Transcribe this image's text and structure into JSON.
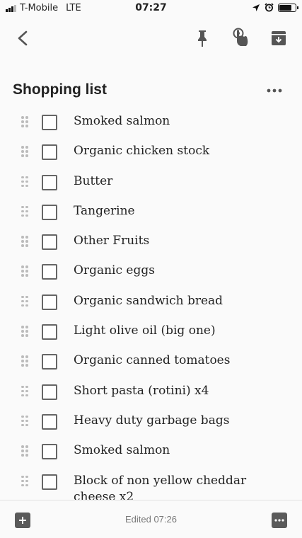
{
  "status_bar": {
    "carrier": "T-Mobile",
    "network": "LTE",
    "time": "07:27",
    "battery_level": 0.85
  },
  "toolbar": {
    "icons": [
      "back-arrow-icon",
      "pin-icon",
      "reminder-icon",
      "archive-icon"
    ]
  },
  "note": {
    "title": "Shopping list",
    "items": [
      {
        "text": "Smoked salmon",
        "checked": false
      },
      {
        "text": "Organic chicken stock",
        "checked": false
      },
      {
        "text": "Butter",
        "checked": false
      },
      {
        "text": "Tangerine",
        "checked": false
      },
      {
        "text": "Other Fruits",
        "checked": false
      },
      {
        "text": "Organic eggs",
        "checked": false
      },
      {
        "text": "Organic sandwich bread",
        "checked": false
      },
      {
        "text": "Light olive oil (big one)",
        "checked": false
      },
      {
        "text": "Organic canned tomatoes",
        "checked": false
      },
      {
        "text": "Short pasta (rotini) x4",
        "checked": false
      },
      {
        "text": "Heavy duty garbage bags",
        "checked": false
      },
      {
        "text": "Smoked salmon",
        "checked": false
      },
      {
        "text": "Block of non yellow cheddar cheese x2",
        "checked": false
      }
    ]
  },
  "bottom_bar": {
    "edited_label": "Edited 07:26"
  },
  "colors": {
    "background": "#fafafa",
    "icon": "#5a5a5a",
    "checkbox_border": "#666666",
    "drag_handle": "#bbbbbb"
  }
}
